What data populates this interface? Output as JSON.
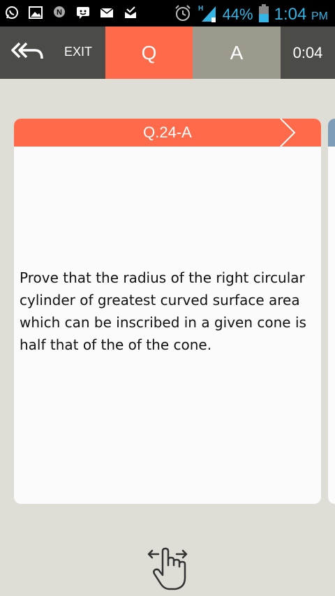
{
  "status_bar": {
    "left_icons": [
      "whatsapp-icon",
      "gallery-icon",
      "n-notification-icon",
      "messenger-icon",
      "gmail-icon",
      "inbox-check-icon"
    ],
    "battery_percent": "44%",
    "time": "1:04",
    "ampm": "PM"
  },
  "toolbar": {
    "exit_label": "EXIT",
    "tab_q_label": "Q",
    "tab_a_label": "A",
    "timer": "0:04"
  },
  "card": {
    "title": "Q.24-A",
    "question": "Prove that the radius of the right circular cylinder of greatest curved surface area which can be inscribed in a given cone is half that of the of the cone."
  },
  "colors": {
    "accent": "#fe6a4a",
    "toolbar": "#4b4b47",
    "answer_tab": "#9b9a8d",
    "background": "#deddd6",
    "status_text": "#33b5e5"
  }
}
